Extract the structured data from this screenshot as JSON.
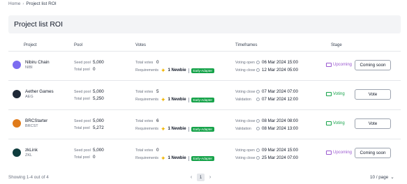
{
  "breadcrumb": {
    "home": "Home",
    "current": "Project list ROI"
  },
  "header": {
    "title": "Project list ROI"
  },
  "columns": {
    "project": "Project",
    "pool": "Pool",
    "votes": "Votes",
    "timeframes": "Timeframes",
    "stage": "Stage"
  },
  "labels": {
    "seed_pool": "Seed pool",
    "total_pool": "Total pool",
    "total_votes": "Total votes",
    "requirements": "Requirements",
    "newbie": "1 Newbie",
    "early_adapter": "Early-Adapter"
  },
  "rows": [
    {
      "name": "Nibiru Chain",
      "ticker": "NIBI",
      "icon": "nibiru-logo-icon",
      "icon_color": "#7c6cf0",
      "seed_pool": "5,000",
      "total_pool": "0",
      "total_votes": "0",
      "tf1_label": "Voting open",
      "tf1_value": "06 Mar 2024 15:00",
      "tf2_label": "Voting close",
      "tf2_value": "12 Mar 2024 05:00",
      "stage": "Upcoming",
      "stage_kind": "upcoming",
      "action": "Coming soon"
    },
    {
      "name": "Aether Games",
      "ticker": "AEG",
      "icon": "aether-logo-icon",
      "icon_color": "#1f2937",
      "seed_pool": "5,000",
      "total_pool": "5,250",
      "total_votes": "5",
      "tf1_label": "Voting close",
      "tf1_value": "07 Mar 2024 07:00",
      "tf2_label": "Validation",
      "tf2_value": "07 Mar 2024 12:00",
      "stage": "Voting",
      "stage_kind": "voting",
      "action": "Vote"
    },
    {
      "name": "BRCStarter",
      "ticker": "BRCST",
      "icon": "brcstarter-logo-icon",
      "icon_color": "#e07b1a",
      "seed_pool": "5,000",
      "total_pool": "5,272",
      "total_votes": "6",
      "tf1_label": "Voting close",
      "tf1_value": "08 Mar 2024 08:00",
      "tf2_label": "Validation",
      "tf2_value": "08 Mar 2024 13:00",
      "stage": "Voting",
      "stage_kind": "voting",
      "action": "Vote"
    },
    {
      "name": "zkLink",
      "ticker": "ZKL",
      "icon": "zklink-logo-icon",
      "icon_color": "#0f3d3e",
      "seed_pool": "5,000",
      "total_pool": "0",
      "total_votes": "0",
      "tf1_label": "Voting open",
      "tf1_value": "09 Mar 2024 15:00",
      "tf2_label": "Voting close",
      "tf2_value": "25 Mar 2024 07:00",
      "stage": "Upcoming",
      "stage_kind": "upcoming",
      "action": "Coming soon"
    }
  ],
  "footer": {
    "showing": "Showing 1-4 out of 4",
    "current_page": "1",
    "page_size": "10 / page"
  },
  "colors": {
    "voting": "#16a34a",
    "upcoming": "#9b59d0",
    "badge": "#16a34a",
    "bolt": "#f2b705"
  }
}
